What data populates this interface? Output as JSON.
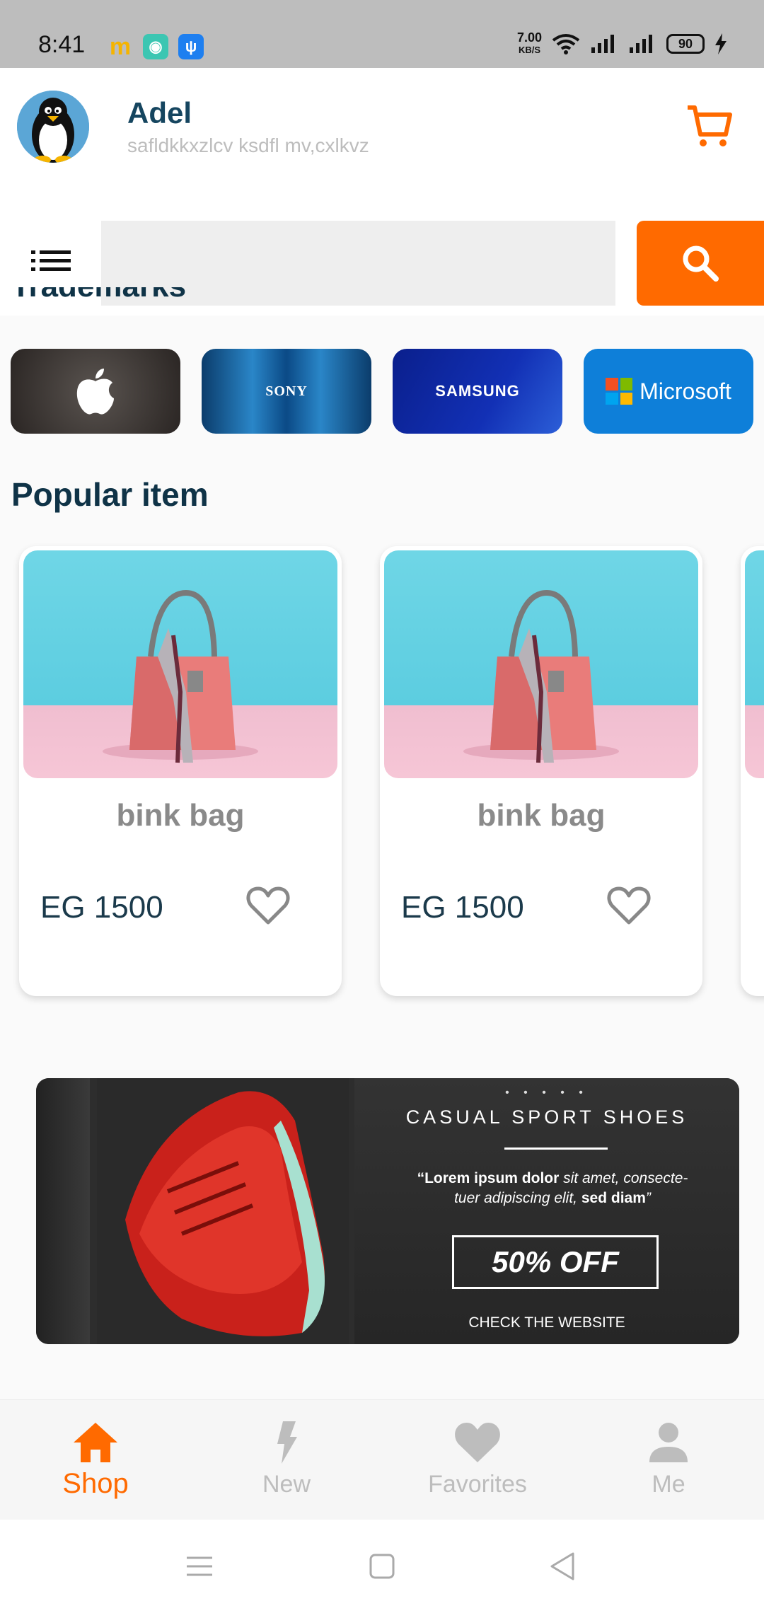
{
  "status_bar": {
    "time": "8:41",
    "speed_value": "7.00",
    "speed_unit": "KB/S",
    "battery": "90"
  },
  "header": {
    "user_name": "Adel",
    "user_subtitle": "safldkkxzlcv ksdfl mv,cxlkvz"
  },
  "search": {
    "placeholder": ""
  },
  "trademarks": {
    "title": "Trademarks",
    "brands": [
      {
        "name": "",
        "icon": "apple-logo-icon"
      },
      {
        "name": "SONY"
      },
      {
        "name": "SAMSUNG"
      },
      {
        "name": "Microsoft"
      }
    ]
  },
  "popular": {
    "title": "Popular item",
    "items": [
      {
        "title": "bink bag",
        "price": "EG 1500"
      },
      {
        "title": "bink bag",
        "price": "EG 1500"
      }
    ]
  },
  "banner": {
    "dots": "• • • • •",
    "title": "CASUAL SPORT SHOES",
    "desc_bold_1": "“Lorem ipsum dolor",
    "desc_text_1": " sit amet, consecte-tuer adipiscing elit, ",
    "desc_bold_2": "sed diam",
    "desc_end": "”",
    "offer": "50% OFF",
    "cta": "CHECK THE WEBSITE"
  },
  "bottom_nav": {
    "items": [
      {
        "label": "Shop",
        "active": true
      },
      {
        "label": "New"
      },
      {
        "label": "Favorites"
      },
      {
        "label": "Me"
      }
    ]
  },
  "colors": {
    "accent": "#ff6a00",
    "title": "#0f3347",
    "inactive": "#bdbdbd"
  }
}
